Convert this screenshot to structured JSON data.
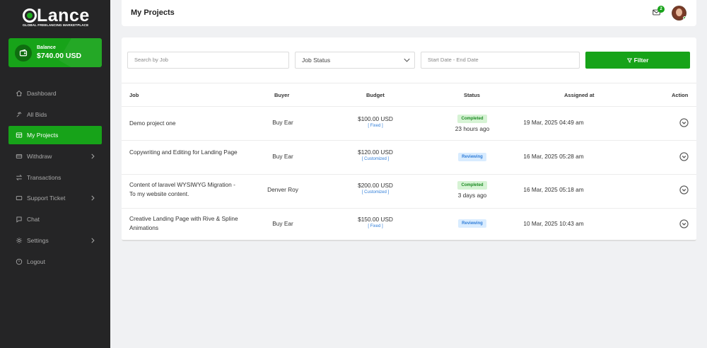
{
  "brand": {
    "name": "Lance",
    "tagline": "GLOBAL FREELANCING MARKETPLACE"
  },
  "balance": {
    "label": "Balance",
    "value": "$740.00 USD"
  },
  "sidebar": {
    "items": [
      {
        "label": "Dashboard",
        "icon": "home-icon",
        "active": false,
        "has_submenu": false
      },
      {
        "label": "All Bids",
        "icon": "gavel-icon",
        "active": false,
        "has_submenu": false
      },
      {
        "label": "My Projects",
        "icon": "projects-icon",
        "active": true,
        "has_submenu": false
      },
      {
        "label": "Withdraw",
        "icon": "withdraw-icon",
        "active": false,
        "has_submenu": true
      },
      {
        "label": "Transactions",
        "icon": "transfer-icon",
        "active": false,
        "has_submenu": false
      },
      {
        "label": "Support Ticket",
        "icon": "ticket-icon",
        "active": false,
        "has_submenu": true
      },
      {
        "label": "Chat",
        "icon": "chat-icon",
        "active": false,
        "has_submenu": false
      },
      {
        "label": "Settings",
        "icon": "gear-icon",
        "active": false,
        "has_submenu": true
      },
      {
        "label": "Logout",
        "icon": "logout-icon",
        "active": false,
        "has_submenu": false
      }
    ]
  },
  "header": {
    "title": "My Projects",
    "notification_count": "2"
  },
  "filters": {
    "search_placeholder": "Search by Job",
    "status_label": "Job Status",
    "date_placeholder": "Start Date - End Date",
    "filter_label": "Filter"
  },
  "table": {
    "headers": {
      "job": "Job",
      "buyer": "Buyer",
      "budget": "Budget",
      "status": "Status",
      "assigned": "Assigned at",
      "action": "Action"
    },
    "rows": [
      {
        "job": "Demo project one",
        "buyer": "Buy Ear",
        "amount": "$100.00 USD",
        "type": "[ Fixed ]",
        "status": "Completed",
        "status_kind": "completed",
        "ago": "23 hours ago",
        "assigned": "19 Mar, 2025 04:49 am"
      },
      {
        "job": "Copywriting and Editing for Landing Page",
        "buyer": "Buy Ear",
        "amount": "$120.00 USD",
        "type": "[ Customized ]",
        "status": "Reviewing",
        "status_kind": "reviewing",
        "ago": "",
        "assigned": "16 Mar, 2025 05:28 am"
      },
      {
        "job": "Content of laravel WYSIWYG Migration - To my website content.",
        "buyer": "Denver Roy",
        "amount": "$200.00 USD",
        "type": "[ Customized ]",
        "status": "Completed",
        "status_kind": "completed",
        "ago": "3 days ago",
        "assigned": "16 Mar, 2025 05:18 am"
      },
      {
        "job": "Creative Landing Page with Rive & Spline Animations",
        "buyer": "Buy Ear",
        "amount": "$150.00 USD",
        "type": "[ Fixed ]",
        "status": "Reviewing",
        "status_kind": "reviewing",
        "ago": "",
        "assigned": "10 Mar, 2025 10:43 am"
      }
    ]
  },
  "colors": {
    "accent": "#17a319",
    "sidebar_bg": "#252526",
    "completed_bg": "#d6f3d4",
    "reviewing_bg": "#d9ecff"
  }
}
